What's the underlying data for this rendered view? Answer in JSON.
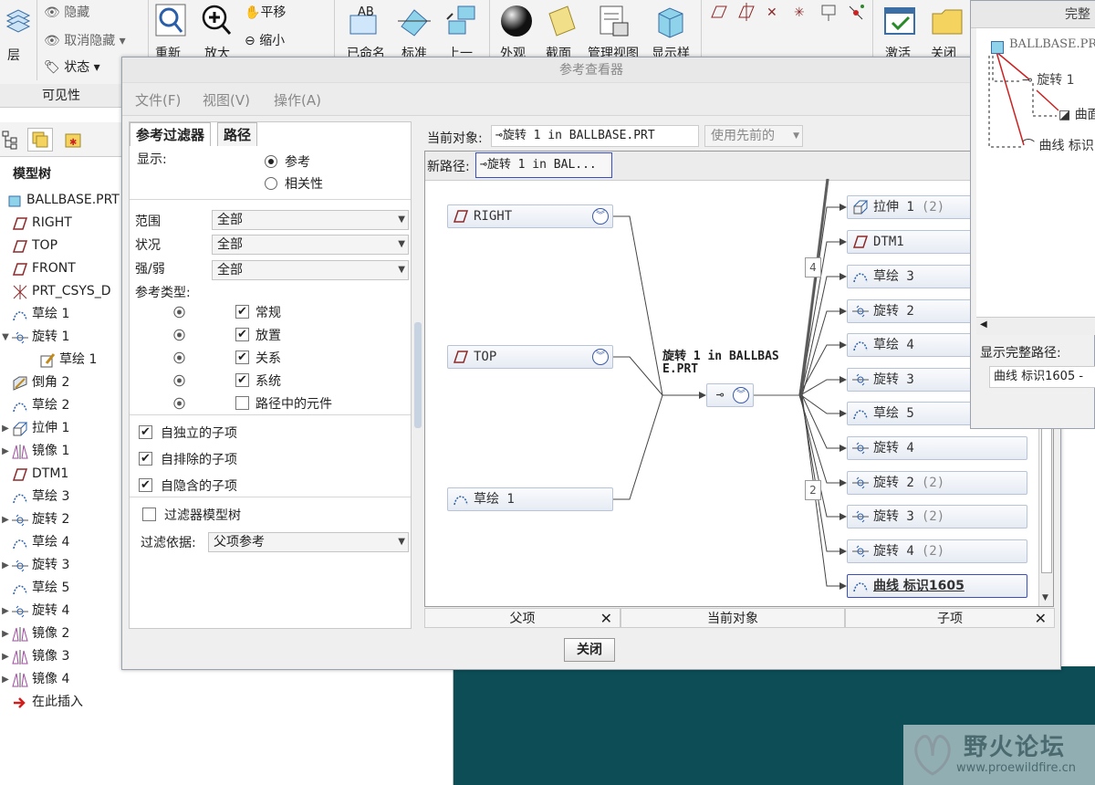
{
  "ribbon": {
    "layer_label": "层",
    "hide_label": "隐藏",
    "unhide_label": "取消隐藏",
    "status_label": "状态",
    "visibility_label": "可见性",
    "pan_label": "平移",
    "zoom_out_label": "缩小",
    "cut_labels": [
      "重新",
      "放大",
      "已命名",
      "标准",
      "上一",
      "外观",
      "截面",
      "管理视图",
      "显示样",
      "激活",
      "关闭"
    ]
  },
  "model_tree": {
    "title": "模型树",
    "items": [
      {
        "label": "BALLBASE.PRT",
        "icon": "part-icon",
        "indent": 0,
        "expand": ""
      },
      {
        "label": "RIGHT",
        "icon": "datum-plane-icon",
        "indent": 1,
        "expand": ""
      },
      {
        "label": "TOP",
        "icon": "datum-plane-icon",
        "indent": 1,
        "expand": ""
      },
      {
        "label": "FRONT",
        "icon": "datum-plane-icon",
        "indent": 1,
        "expand": ""
      },
      {
        "label": "PRT_CSYS_D",
        "icon": "csys-icon",
        "indent": 1,
        "expand": ""
      },
      {
        "label": "草绘 1",
        "icon": "sketch-icon",
        "indent": 1,
        "expand": ""
      },
      {
        "label": "旋转 1",
        "icon": "revolve-icon",
        "indent": 1,
        "expand": "▼"
      },
      {
        "label": "草绘 1",
        "icon": "sketch-edit-icon",
        "indent": 2,
        "expand": ""
      },
      {
        "label": "倒角 2",
        "icon": "chamfer-icon",
        "indent": 1,
        "expand": ""
      },
      {
        "label": "草绘 2",
        "icon": "sketch-icon",
        "indent": 1,
        "expand": ""
      },
      {
        "label": "拉伸 1",
        "icon": "extrude-icon",
        "indent": 1,
        "expand": "▶"
      },
      {
        "label": "镜像 1",
        "icon": "mirror-icon",
        "indent": 1,
        "expand": "▶"
      },
      {
        "label": "DTM1",
        "icon": "datum-plane-icon",
        "indent": 1,
        "expand": ""
      },
      {
        "label": "草绘 3",
        "icon": "sketch-icon",
        "indent": 1,
        "expand": ""
      },
      {
        "label": "旋转 2",
        "icon": "revolve-icon",
        "indent": 1,
        "expand": "▶"
      },
      {
        "label": "草绘 4",
        "icon": "sketch-icon",
        "indent": 1,
        "expand": ""
      },
      {
        "label": "旋转 3",
        "icon": "revolve-icon",
        "indent": 1,
        "expand": "▶"
      },
      {
        "label": "草绘 5",
        "icon": "sketch-icon",
        "indent": 1,
        "expand": ""
      },
      {
        "label": "旋转 4",
        "icon": "revolve-icon",
        "indent": 1,
        "expand": "▶"
      },
      {
        "label": "镜像 2",
        "icon": "mirror-icon",
        "indent": 1,
        "expand": "▶"
      },
      {
        "label": "镜像 3",
        "icon": "mirror-icon",
        "indent": 1,
        "expand": "▶"
      },
      {
        "label": "镜像 4",
        "icon": "mirror-icon",
        "indent": 1,
        "expand": "▶"
      },
      {
        "label": "在此插入",
        "icon": "insert-arrow-icon",
        "indent": 1,
        "expand": ""
      }
    ]
  },
  "dialog": {
    "title": "参考查看器",
    "menu": [
      "文件(F)",
      "视图(V)",
      "操作(A)"
    ],
    "tabs": [
      "参考过滤器",
      "路径"
    ],
    "display_label": "显示:",
    "radio_reference": "参考",
    "radio_relevance": "相关性",
    "scope_label": "范围",
    "scope_value": "全部",
    "status_label": "状况",
    "status_value": "全部",
    "strength_label": "强/弱",
    "strength_value": "全部",
    "ref_type_label": "参考类型:",
    "ref_types": [
      {
        "label": "常规",
        "checked": "✔"
      },
      {
        "label": "放置",
        "checked": "✔"
      },
      {
        "label": "关系",
        "checked": "✔"
      },
      {
        "label": "系统",
        "checked": "✔"
      },
      {
        "label": "路径中的元件",
        "checked": ""
      }
    ],
    "child_opts": [
      {
        "label": "自独立的子项",
        "checked": "✔"
      },
      {
        "label": "自排除的子项",
        "checked": "✔"
      },
      {
        "label": "自隐含的子项",
        "checked": "✔"
      }
    ],
    "filter_tree_label": "过滤器模型树",
    "filter_by_label": "过滤依据:",
    "filter_by_value": "父项参考",
    "current_obj_label": "当前对象:",
    "current_obj_value": "旋转 1 in BALLBASE.PRT",
    "use_previous_label": "使用先前的",
    "new_path_label": "新路径:",
    "new_path_value": "旋转 1 in BAL...",
    "parents": [
      "RIGHT",
      "TOP",
      "草绘 1"
    ],
    "center_title_line1": "旋转 1 in BALLBAS",
    "center_title_line2": "E.PRT",
    "children": [
      {
        "label": "拉伸 1",
        "count": "(2)",
        "icon": "extrude-icon"
      },
      {
        "label": "DTM1",
        "count": "",
        "icon": "datum-plane-icon"
      },
      {
        "label": "草绘 3",
        "count": "",
        "icon": "sketch-icon"
      },
      {
        "label": "旋转 2",
        "count": "",
        "icon": "revolve-icon"
      },
      {
        "label": "草绘 4",
        "count": "",
        "icon": "sketch-icon"
      },
      {
        "label": "旋转 3",
        "count": "",
        "icon": "revolve-icon"
      },
      {
        "label": "草绘 5",
        "count": "",
        "icon": "sketch-icon"
      },
      {
        "label": "旋转 4",
        "count": "",
        "icon": "revolve-icon"
      },
      {
        "label": "旋转 2",
        "count": "(2)",
        "icon": "revolve-icon"
      },
      {
        "label": "旋转 3",
        "count": "(2)",
        "icon": "revolve-icon"
      },
      {
        "label": "旋转 4",
        "count": "(2)",
        "icon": "revolve-icon"
      },
      {
        "label": "曲线 标识1605",
        "count": "",
        "icon": "sketch-icon"
      }
    ],
    "group_badges": [
      "4",
      "2"
    ],
    "col_parent": "父项",
    "col_current": "当前对象",
    "col_child": "子项",
    "close_button": "关闭"
  },
  "right_window": {
    "title": "完整",
    "root": "BALLBASE.PRT",
    "node1": "旋转 1",
    "node2": "曲面",
    "node3": "曲线 标识",
    "full_path_label": "显示完整路径:",
    "full_path_value": "曲线 标识1605 -"
  },
  "watermark": {
    "title": "野火论坛",
    "url": "www.proewildfire.cn"
  },
  "colors": {
    "desktop": "#0d4d55",
    "node_border": "#b8c4d6",
    "accent_link": "#3a4fbf",
    "arrow_red": "#cc2222"
  }
}
